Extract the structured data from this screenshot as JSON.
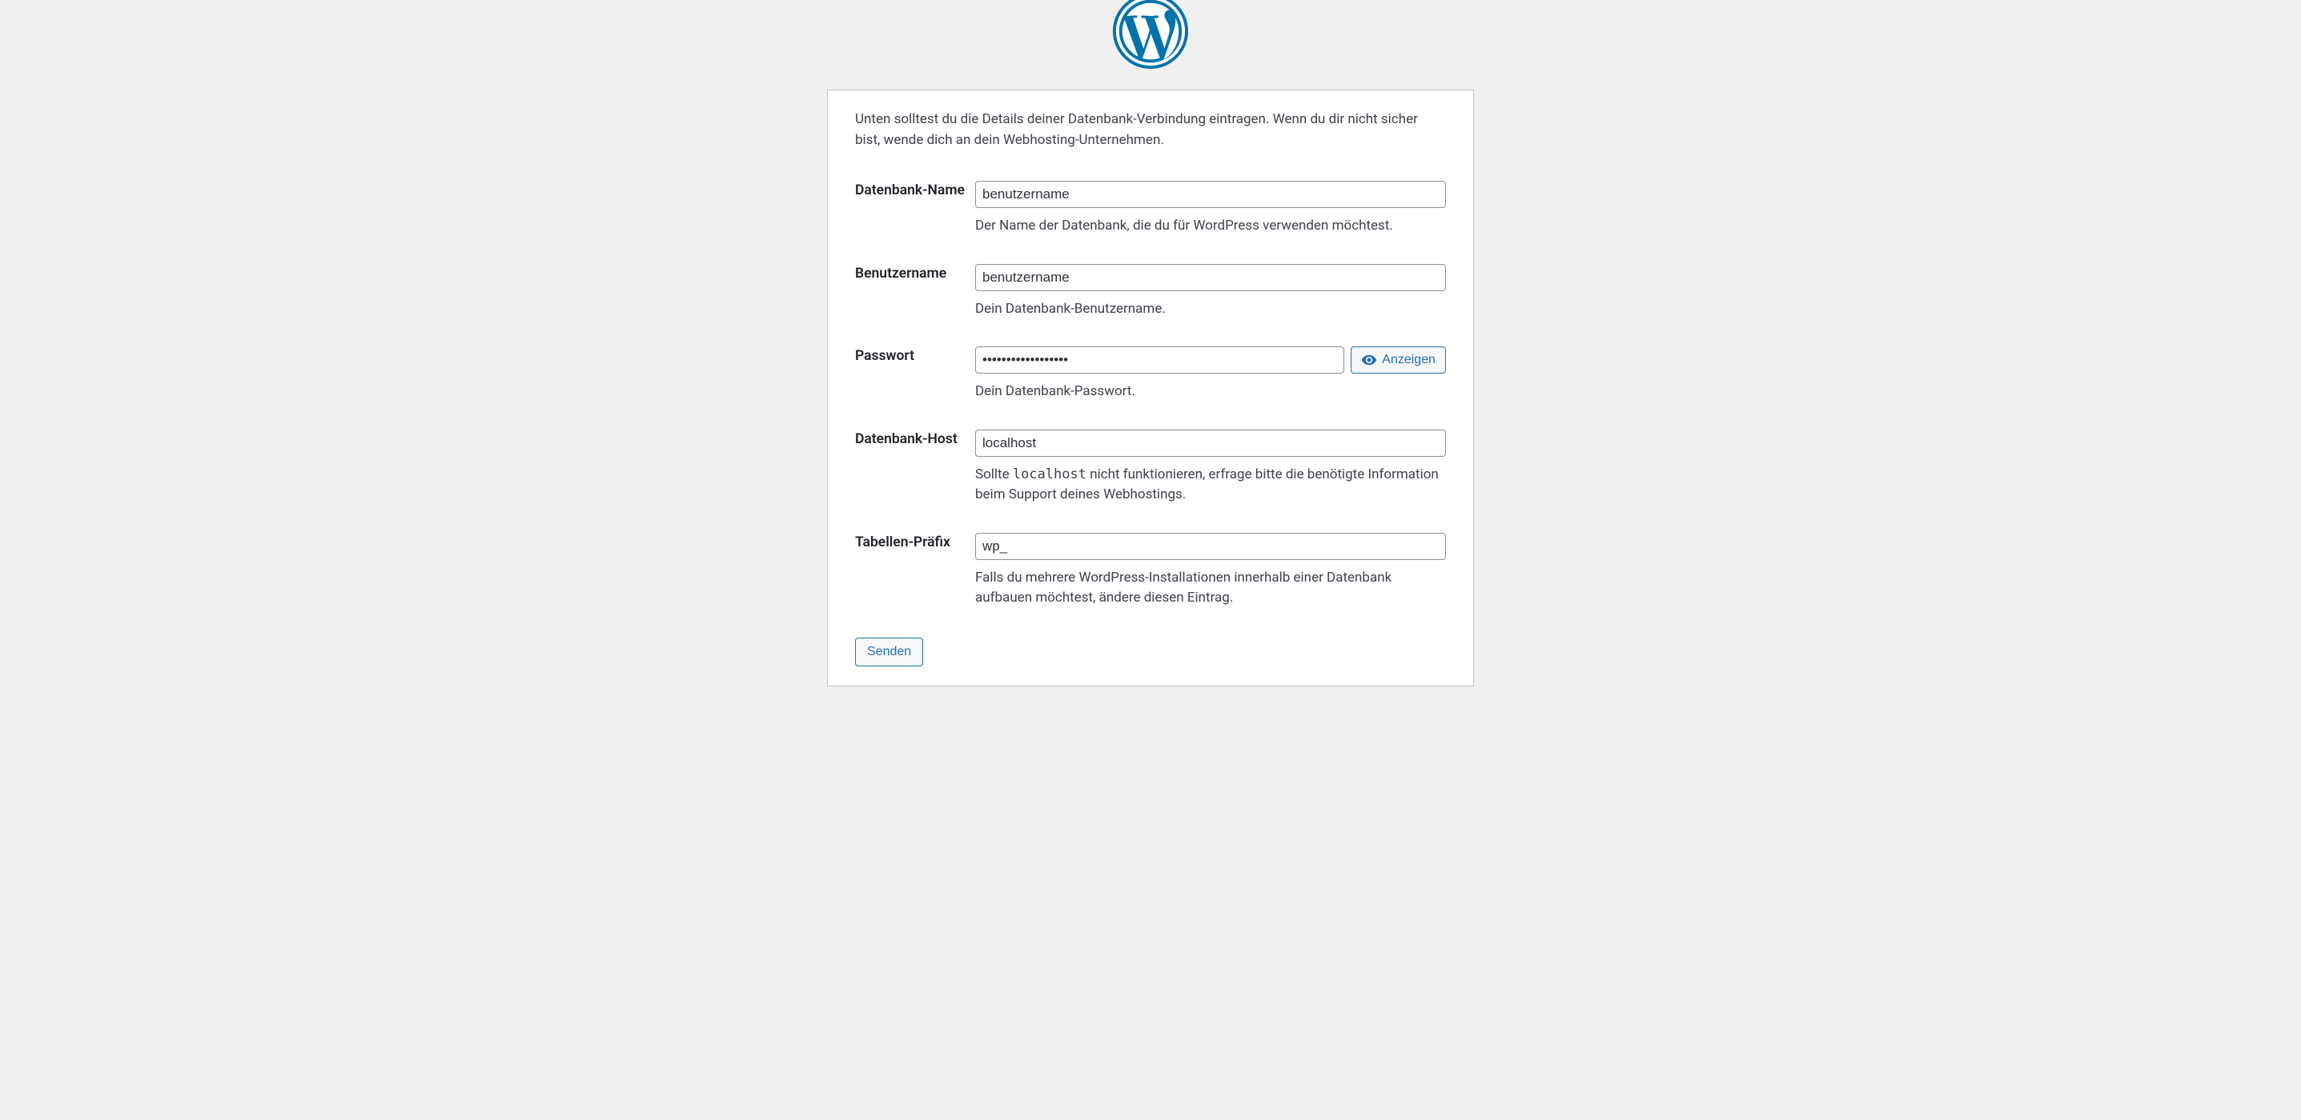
{
  "intro": "Unten solltest du die Details deiner Datenbank-Verbindung eintragen. Wenn du dir nicht sicher bist, wende dich an dein Webhosting-Unternehmen.",
  "fields": {
    "dbname": {
      "label": "Datenbank-Name",
      "value": "benutzername",
      "description": "Der Name der Datenbank, die du für WordPress verwenden möchtest."
    },
    "username": {
      "label": "Benutzername",
      "value": "benutzername",
      "description": "Dein Datenbank-Benutzername."
    },
    "password": {
      "label": "Passwort",
      "value": "••••••••••••••••••",
      "description": "Dein Datenbank-Passwort.",
      "show_button": "Anzeigen"
    },
    "dbhost": {
      "label": "Datenbank-Host",
      "value": "localhost",
      "description_pre": "Sollte ",
      "description_code": "localhost",
      "description_post": " nicht funktionieren, erfrage bitte die benötigte Information beim Support deines Webhostings."
    },
    "prefix": {
      "label": "Tabellen-Präfix",
      "value": "wp_",
      "description": "Falls du mehrere WordPress-Installationen innerhalb einer Datenbank aufbauen möchtest, ändere diesen Eintrag."
    }
  },
  "submit_label": "Senden"
}
